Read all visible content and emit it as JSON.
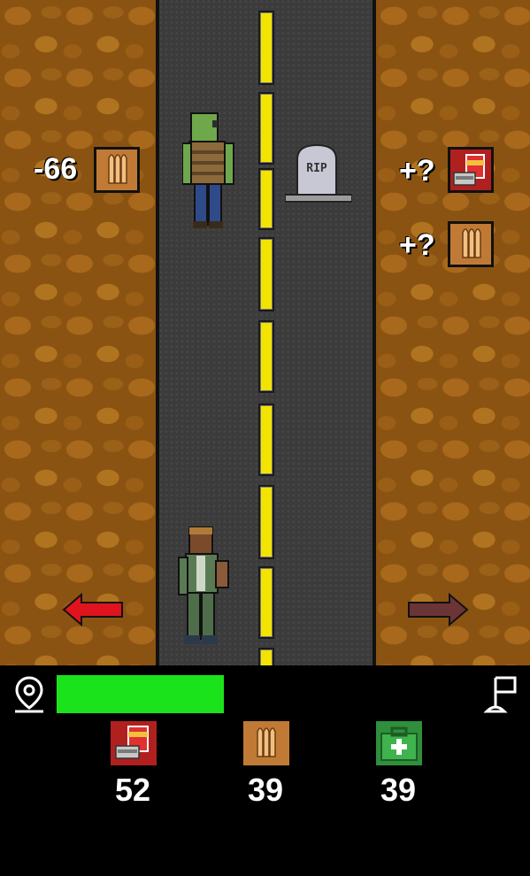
{
  "scene": {
    "left_item": {
      "value": "-66",
      "icon": "ammo-icon"
    },
    "right_items": [
      {
        "value": "+?",
        "icon": "food-can-icon"
      },
      {
        "value": "+?",
        "icon": "ammo-icon"
      }
    ],
    "gravestone_text": "RIP"
  },
  "hud": {
    "health_level": 0.42,
    "stats": [
      {
        "icon": "food-can-icon",
        "value": "52"
      },
      {
        "icon": "ammo-icon",
        "value": "39"
      },
      {
        "icon": "medkit-icon",
        "value": "39"
      }
    ]
  },
  "colors": {
    "health": "#1be31b",
    "left_arrow": "#e0141e",
    "right_arrow": "#6b3437",
    "lane": "#f2e400"
  }
}
